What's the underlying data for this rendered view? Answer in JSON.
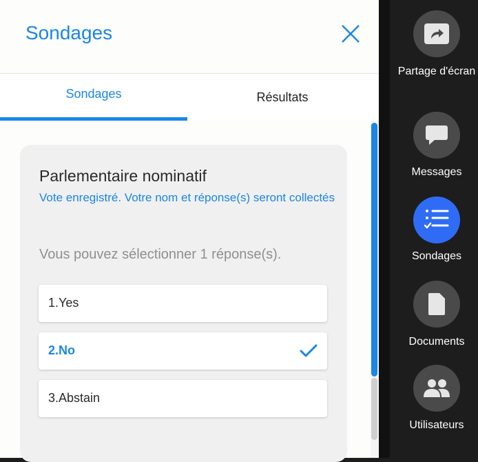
{
  "panel": {
    "title": "Sondages",
    "tabs": [
      {
        "label": "Sondages",
        "active": true
      },
      {
        "label": "Résultats",
        "active": false
      }
    ]
  },
  "poll": {
    "title": "Parlementaire nominatif",
    "note": "Vote enregistré. Votre nom et réponse(s) seront collectés",
    "instruction": "Vous pouvez sélectionner 1 réponse(s).",
    "options": [
      {
        "label": "1.Yes",
        "selected": false
      },
      {
        "label": "2.No",
        "selected": true
      },
      {
        "label": "3.Abstain",
        "selected": false
      }
    ]
  },
  "sidebar": {
    "items": [
      {
        "label": "Partage d'écran",
        "icon": "share-screen-icon",
        "active": false
      },
      {
        "label": "Messages",
        "icon": "chat-bubble-icon",
        "active": false
      },
      {
        "label": "Sondages",
        "icon": "poll-checklist-icon",
        "active": true
      },
      {
        "label": "Documents",
        "icon": "document-icon",
        "active": false
      },
      {
        "label": "Utilisateurs",
        "icon": "users-icon",
        "active": false
      }
    ]
  },
  "colors": {
    "accent": "#1a86e8",
    "active_sidebar": "#2f6cf6",
    "sidebar_bg": "#1d1d1d",
    "icon_circle": "#4a4a4a"
  }
}
